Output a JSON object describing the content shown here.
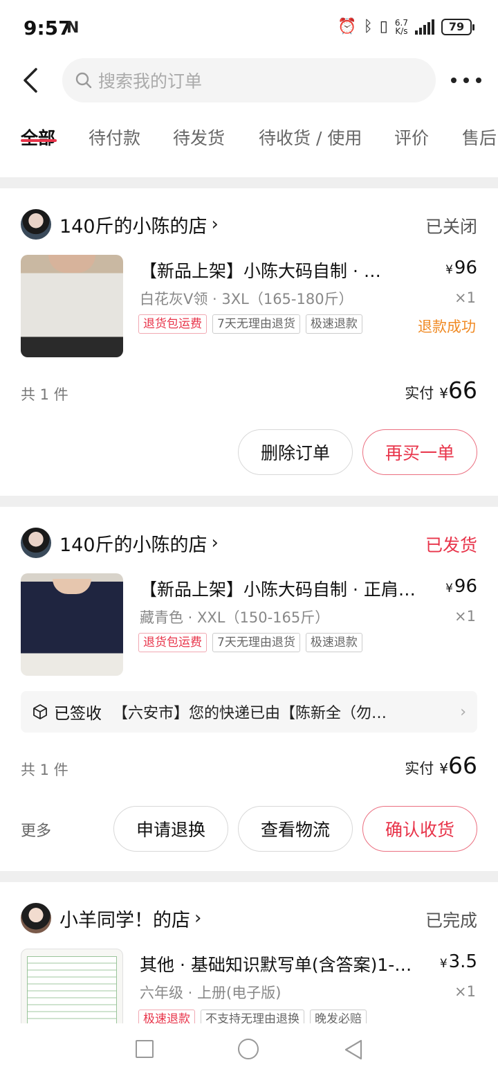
{
  "status_bar": {
    "time": "9:57",
    "nfc": "N",
    "net_speed_top": "6.7",
    "net_speed_bottom": "K/s",
    "battery": "79"
  },
  "header": {
    "search_placeholder": "搜索我的订单"
  },
  "tabs": [
    "全部",
    "待付款",
    "待发货",
    "待收货 / 使用",
    "评价",
    "售后"
  ],
  "orders": [
    {
      "shop": "140斤的小陈的店",
      "status": "已关闭",
      "status_color": "#555555",
      "title": "【新品上架】小陈大码自制 · …",
      "currency": "¥",
      "price": "96",
      "spec": "白花灰V领 · 3XL（165-180斤）",
      "qty": "×1",
      "tags": [
        "退货包运费",
        "7天无理由退货",
        "极速退款"
      ],
      "refund_status": "退款成功",
      "count": "共 1 件",
      "paid_label": "实付",
      "paid": "66",
      "buttons": [
        "删除订单",
        "再买一单"
      ]
    },
    {
      "shop": "140斤的小陈的店",
      "status": "已发货",
      "status_color": "#e8344a",
      "title": "【新品上架】小陈大码自制 · 正肩…",
      "currency": "¥",
      "price": "96",
      "spec": "藏青色 · XXL（150-165斤）",
      "qty": "×1",
      "tags": [
        "退货包运费",
        "7天无理由退货",
        "极速退款"
      ],
      "logistics_status": "已签收",
      "logistics_text": "【六安市】您的快递已由【陈新全（勿…",
      "count": "共 1 件",
      "paid_label": "实付",
      "paid": "66",
      "more": "更多",
      "buttons": [
        "申请退换",
        "查看物流",
        "确认收货"
      ]
    },
    {
      "shop": "小羊同学！的店",
      "status": "已完成",
      "status_color": "#555555",
      "title": "其他 · 基础知识默写单(含答案)1-…",
      "currency": "¥",
      "price": "3.5",
      "spec": "六年级 · 上册(电子版)",
      "qty": "×1",
      "tags": [
        "极速退款",
        "不支持无理由退换",
        "晚发必赔"
      ]
    }
  ]
}
